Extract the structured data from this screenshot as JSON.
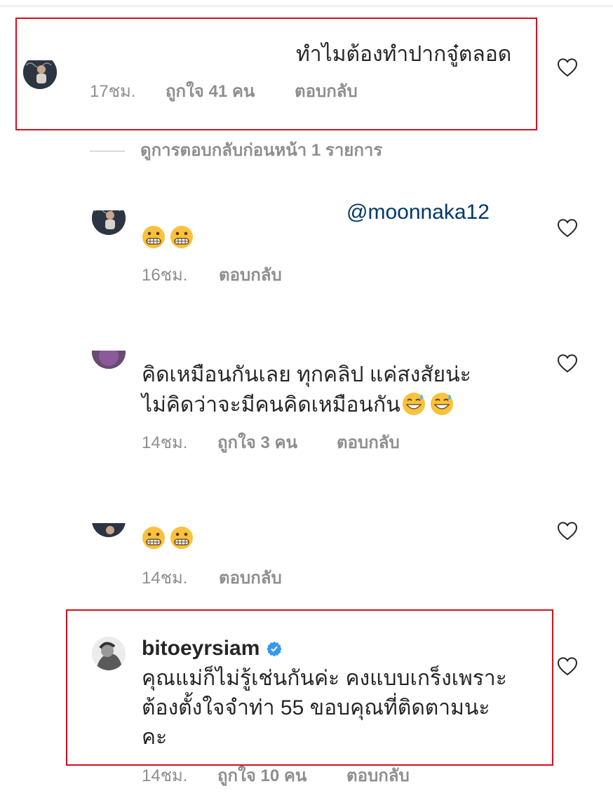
{
  "comments": [
    {
      "text": "ทำไมต้องทำปากจู๋ตลอด",
      "time": "17ชม.",
      "likes": "ถูกใจ 41 คน",
      "reply": "ตอบกลับ",
      "highlighted": true
    },
    {
      "mention": "@moonnaka12",
      "emojis": [
        "grimacing-face",
        "grimacing-face"
      ],
      "time": "16ชม.",
      "reply": "ตอบกลับ"
    },
    {
      "lines": [
        "คิดเหมือนกันเลย ทุกคลิป  แค่สงสัยน่ะ",
        "ไม่คิดว่าจะมีคนคิดเหมือนกัน"
      ],
      "emojis": [
        "grinning-sweat",
        "grinning-sweat"
      ],
      "time": "14ชม.",
      "likes": "ถูกใจ 3 คน",
      "reply": "ตอบกลับ"
    },
    {
      "emojis": [
        "grimacing-face",
        "grimacing-face"
      ],
      "time": "14ชม.",
      "reply": "ตอบกลับ"
    },
    {
      "username": "bitoeyrsiam",
      "verified": true,
      "lines": [
        "คุณแม่ก็ไม่รู้เช่นกันค่ะ คงแบบเกร็งเพราะ",
        "ต้องตั้งใจจำท่า 55 ขอบคุณที่ติดตามนะ",
        "คะ"
      ],
      "time": "14ชม.",
      "likes": "ถูกใจ 10 คน",
      "reply": "ตอบกลับ",
      "highlighted": true
    }
  ],
  "view_replies": "ดูการตอบกลับก่อนหน้า 1 รายการ",
  "colors": {
    "highlight_box": "#d0101e",
    "mention": "#00376b",
    "muted_text": "#8e8e8e",
    "verified_badge": "#3897f0"
  },
  "icons": [
    "heart-outline-icon",
    "verified-badge-icon"
  ]
}
